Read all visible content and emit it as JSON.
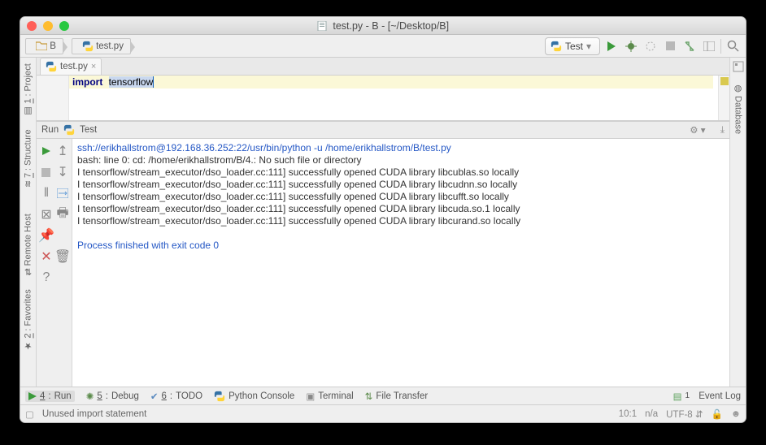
{
  "title": "test.py - B - [~/Desktop/B]",
  "breadcrumb": [
    {
      "icon": "folder",
      "label": "B"
    },
    {
      "icon": "python",
      "label": "test.py"
    }
  ],
  "run_config": {
    "icon": "python",
    "label": "Test"
  },
  "toolbar_icons": [
    "run",
    "debug",
    "coverage",
    "stop",
    "rerun"
  ],
  "left_tool_tabs": [
    {
      "key": "1",
      "label": "Project"
    },
    {
      "key": "7",
      "label": "Structure"
    },
    {
      "key": "",
      "label": "Remote Host"
    },
    {
      "key": "2",
      "label": "Favorites"
    }
  ],
  "right_tool_tabs": [
    {
      "label": "Database"
    }
  ],
  "editor_tab": {
    "label": "test.py",
    "closeable": true
  },
  "code": {
    "keyword": "import",
    "selected": "tensorflow"
  },
  "run_panel": {
    "header_left": "Run",
    "header_cfg": "Test",
    "lines": [
      {
        "cls": "blue",
        "text": "ssh://erikhallstrom@192.168.36.252:22/usr/bin/python -u /home/erikhallstrom/B/test.py"
      },
      {
        "cls": "",
        "text": "bash: line 0: cd: /home/erikhallstrom/B/4.: No such file or directory"
      },
      {
        "cls": "",
        "text": "I tensorflow/stream_executor/dso_loader.cc:111] successfully opened CUDA library libcublas.so locally"
      },
      {
        "cls": "",
        "text": "I tensorflow/stream_executor/dso_loader.cc:111] successfully opened CUDA library libcudnn.so locally"
      },
      {
        "cls": "",
        "text": "I tensorflow/stream_executor/dso_loader.cc:111] successfully opened CUDA library libcufft.so locally"
      },
      {
        "cls": "",
        "text": "I tensorflow/stream_executor/dso_loader.cc:111] successfully opened CUDA library libcuda.so.1 locally"
      },
      {
        "cls": "",
        "text": "I tensorflow/stream_executor/dso_loader.cc:111] successfully opened CUDA library libcurand.so locally"
      },
      {
        "cls": "",
        "text": ""
      },
      {
        "cls": "blue",
        "text": "Process finished with exit code 0"
      }
    ]
  },
  "bottom_tabs": {
    "run": {
      "key": "4",
      "label": "Run"
    },
    "debug": {
      "key": "5",
      "label": "Debug"
    },
    "todo": {
      "key": "6",
      "label": "TODO"
    },
    "pyconsole": {
      "label": "Python Console"
    },
    "terminal": {
      "label": "Terminal"
    },
    "filetransfer": {
      "label": "File Transfer"
    },
    "eventlog": {
      "label": "Event Log",
      "count": "1"
    }
  },
  "status": {
    "message": "Unused import statement",
    "pos": "10:1",
    "insert": "n/a",
    "encoding": "UTF-8"
  }
}
